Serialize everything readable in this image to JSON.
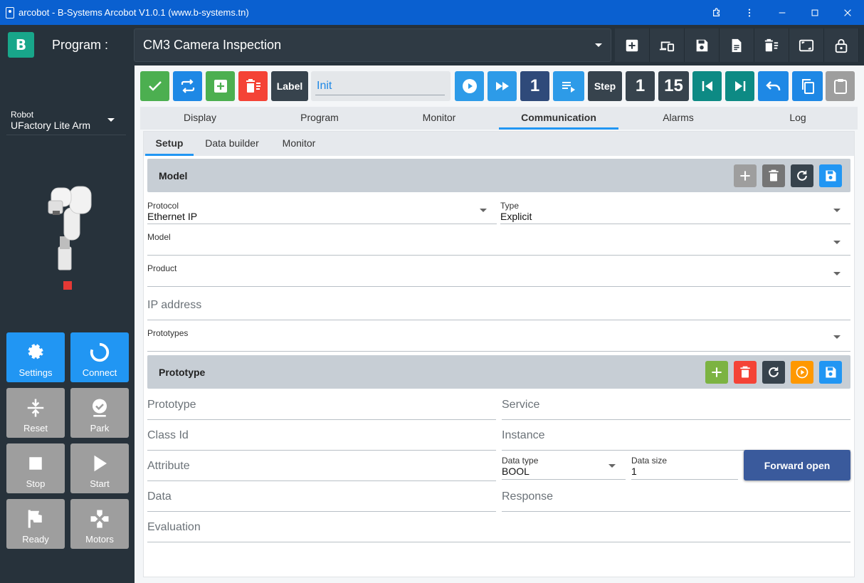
{
  "window": {
    "title": "arcobot - B-Systems Arcobot V1.0.1 (www.b-systems.tn)"
  },
  "header": {
    "logo_text": "B",
    "program_label": "Program :",
    "program_value": "CM3 Camera Inspection",
    "buttons": [
      "add-icon",
      "devices-icon",
      "save-icon",
      "file-icon",
      "delete-list-icon",
      "screen-icon",
      "lock-icon"
    ]
  },
  "sidebar": {
    "robot_label": "Robot",
    "robot_value": "UFactory Lite Arm",
    "status_color": "#e53935",
    "buttons": {
      "settings": "Settings",
      "connect": "Connect",
      "reset": "Reset",
      "park": "Park",
      "stop": "Stop",
      "start": "Start",
      "ready": "Ready",
      "motors": "Motors"
    }
  },
  "toolbar": {
    "label_btn": "Label",
    "init_value": "Init",
    "count": "1",
    "step_label": "Step",
    "step_value": "1",
    "step_total": "15"
  },
  "tabs": [
    "Display",
    "Program",
    "Monitor",
    "Communication",
    "Alarms",
    "Log"
  ],
  "active_tab": "Communication",
  "subtabs": [
    "Setup",
    "Data builder",
    "Monitor"
  ],
  "active_subtab": "Setup",
  "model_section": {
    "title": "Model",
    "protocol_label": "Protocol",
    "protocol_value": "Ethernet IP",
    "type_label": "Type",
    "type_value": "Explicit",
    "model_label": "Model",
    "product_label": "Product",
    "ip_placeholder": "IP address",
    "prototypes_label": "Prototypes"
  },
  "prototype_section": {
    "title": "Prototype",
    "prototype_placeholder": "Prototype",
    "service_placeholder": "Service",
    "classid_placeholder": "Class Id",
    "instance_placeholder": "Instance",
    "attribute_placeholder": "Attribute",
    "datatype_label": "Data type",
    "datatype_value": "BOOL",
    "datasize_label": "Data size",
    "datasize_value": "1",
    "forward_open": "Forward open",
    "data_placeholder": "Data",
    "response_placeholder": "Response",
    "evaluation_placeholder": "Evaluation"
  }
}
